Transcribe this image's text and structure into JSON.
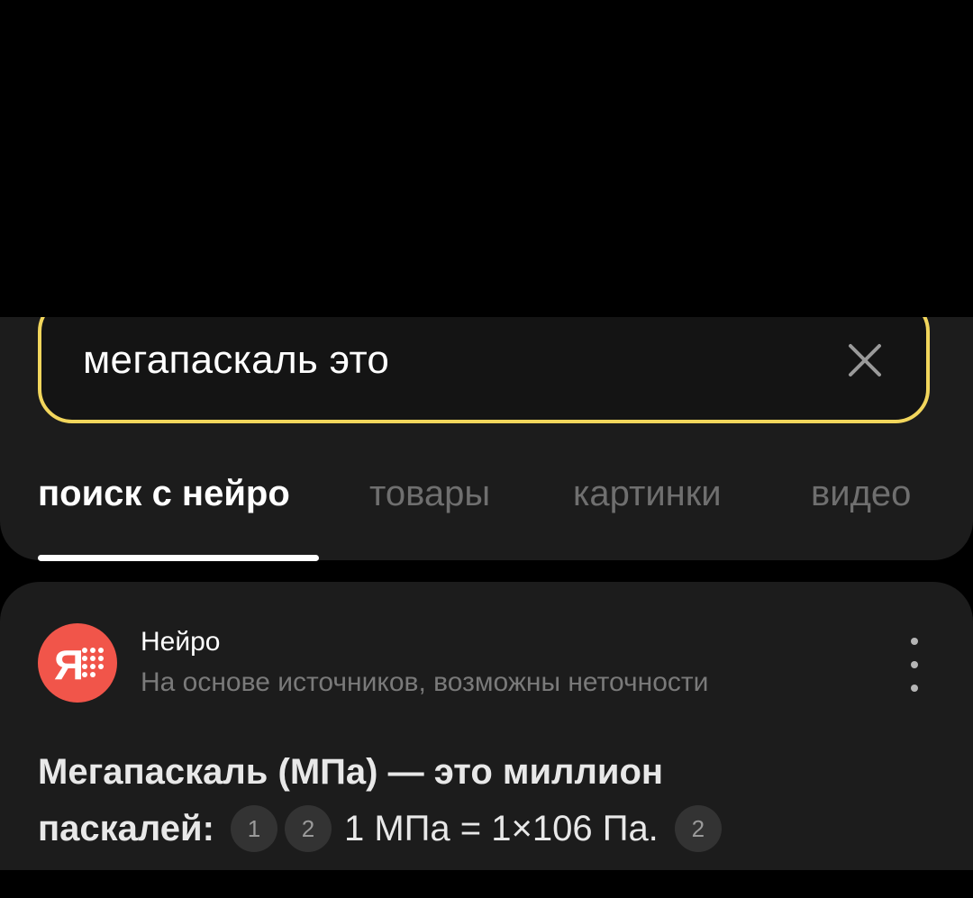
{
  "search": {
    "query": "мегапаскаль это"
  },
  "tabs": [
    {
      "label": "поиск с нейро",
      "active": true
    },
    {
      "label": "товары",
      "active": false
    },
    {
      "label": "картинки",
      "active": false
    },
    {
      "label": "видео",
      "active": false
    }
  ],
  "answer": {
    "source_name": "Нейро",
    "disclaimer": "На основе источников, возможны неточности",
    "line1": "Мегапаскаль (МПа) — это миллион",
    "line2_bold": "паскалей:",
    "citations_a": [
      "1",
      "2"
    ],
    "line2_text": "1 МПа = 1×106 Па.",
    "citation_b": "2"
  },
  "icons": {
    "clear": "close-icon",
    "brand": "yandex-neuro-logo",
    "more": "more-vertical-icon"
  },
  "colors": {
    "background": "#000000",
    "panel": "#1c1c1c",
    "accent_border": "#f2d65c",
    "brand_red": "#f1554a",
    "inactive_tab": "#6f6f6f"
  }
}
